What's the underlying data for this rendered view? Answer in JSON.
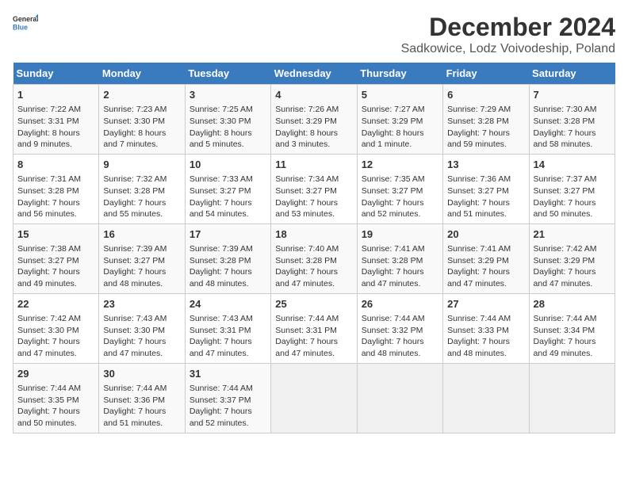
{
  "header": {
    "logo_line1": "General",
    "logo_line2": "Blue",
    "title": "December 2024",
    "subtitle": "Sadkowice, Lodz Voivodeship, Poland"
  },
  "calendar": {
    "days_of_week": [
      "Sunday",
      "Monday",
      "Tuesday",
      "Wednesday",
      "Thursday",
      "Friday",
      "Saturday"
    ],
    "weeks": [
      [
        {
          "day": "1",
          "info": "Sunrise: 7:22 AM\nSunset: 3:31 PM\nDaylight: 8 hours\nand 9 minutes."
        },
        {
          "day": "2",
          "info": "Sunrise: 7:23 AM\nSunset: 3:30 PM\nDaylight: 8 hours\nand 7 minutes."
        },
        {
          "day": "3",
          "info": "Sunrise: 7:25 AM\nSunset: 3:30 PM\nDaylight: 8 hours\nand 5 minutes."
        },
        {
          "day": "4",
          "info": "Sunrise: 7:26 AM\nSunset: 3:29 PM\nDaylight: 8 hours\nand 3 minutes."
        },
        {
          "day": "5",
          "info": "Sunrise: 7:27 AM\nSunset: 3:29 PM\nDaylight: 8 hours\nand 1 minute."
        },
        {
          "day": "6",
          "info": "Sunrise: 7:29 AM\nSunset: 3:28 PM\nDaylight: 7 hours\nand 59 minutes."
        },
        {
          "day": "7",
          "info": "Sunrise: 7:30 AM\nSunset: 3:28 PM\nDaylight: 7 hours\nand 58 minutes."
        }
      ],
      [
        {
          "day": "8",
          "info": "Sunrise: 7:31 AM\nSunset: 3:28 PM\nDaylight: 7 hours\nand 56 minutes."
        },
        {
          "day": "9",
          "info": "Sunrise: 7:32 AM\nSunset: 3:28 PM\nDaylight: 7 hours\nand 55 minutes."
        },
        {
          "day": "10",
          "info": "Sunrise: 7:33 AM\nSunset: 3:27 PM\nDaylight: 7 hours\nand 54 minutes."
        },
        {
          "day": "11",
          "info": "Sunrise: 7:34 AM\nSunset: 3:27 PM\nDaylight: 7 hours\nand 53 minutes."
        },
        {
          "day": "12",
          "info": "Sunrise: 7:35 AM\nSunset: 3:27 PM\nDaylight: 7 hours\nand 52 minutes."
        },
        {
          "day": "13",
          "info": "Sunrise: 7:36 AM\nSunset: 3:27 PM\nDaylight: 7 hours\nand 51 minutes."
        },
        {
          "day": "14",
          "info": "Sunrise: 7:37 AM\nSunset: 3:27 PM\nDaylight: 7 hours\nand 50 minutes."
        }
      ],
      [
        {
          "day": "15",
          "info": "Sunrise: 7:38 AM\nSunset: 3:27 PM\nDaylight: 7 hours\nand 49 minutes."
        },
        {
          "day": "16",
          "info": "Sunrise: 7:39 AM\nSunset: 3:27 PM\nDaylight: 7 hours\nand 48 minutes."
        },
        {
          "day": "17",
          "info": "Sunrise: 7:39 AM\nSunset: 3:28 PM\nDaylight: 7 hours\nand 48 minutes."
        },
        {
          "day": "18",
          "info": "Sunrise: 7:40 AM\nSunset: 3:28 PM\nDaylight: 7 hours\nand 47 minutes."
        },
        {
          "day": "19",
          "info": "Sunrise: 7:41 AM\nSunset: 3:28 PM\nDaylight: 7 hours\nand 47 minutes."
        },
        {
          "day": "20",
          "info": "Sunrise: 7:41 AM\nSunset: 3:29 PM\nDaylight: 7 hours\nand 47 minutes."
        },
        {
          "day": "21",
          "info": "Sunrise: 7:42 AM\nSunset: 3:29 PM\nDaylight: 7 hours\nand 47 minutes."
        }
      ],
      [
        {
          "day": "22",
          "info": "Sunrise: 7:42 AM\nSunset: 3:30 PM\nDaylight: 7 hours\nand 47 minutes."
        },
        {
          "day": "23",
          "info": "Sunrise: 7:43 AM\nSunset: 3:30 PM\nDaylight: 7 hours\nand 47 minutes."
        },
        {
          "day": "24",
          "info": "Sunrise: 7:43 AM\nSunset: 3:31 PM\nDaylight: 7 hours\nand 47 minutes."
        },
        {
          "day": "25",
          "info": "Sunrise: 7:44 AM\nSunset: 3:31 PM\nDaylight: 7 hours\nand 47 minutes."
        },
        {
          "day": "26",
          "info": "Sunrise: 7:44 AM\nSunset: 3:32 PM\nDaylight: 7 hours\nand 48 minutes."
        },
        {
          "day": "27",
          "info": "Sunrise: 7:44 AM\nSunset: 3:33 PM\nDaylight: 7 hours\nand 48 minutes."
        },
        {
          "day": "28",
          "info": "Sunrise: 7:44 AM\nSunset: 3:34 PM\nDaylight: 7 hours\nand 49 minutes."
        }
      ],
      [
        {
          "day": "29",
          "info": "Sunrise: 7:44 AM\nSunset: 3:35 PM\nDaylight: 7 hours\nand 50 minutes."
        },
        {
          "day": "30",
          "info": "Sunrise: 7:44 AM\nSunset: 3:36 PM\nDaylight: 7 hours\nand 51 minutes."
        },
        {
          "day": "31",
          "info": "Sunrise: 7:44 AM\nSunset: 3:37 PM\nDaylight: 7 hours\nand 52 minutes."
        },
        {
          "day": "",
          "info": ""
        },
        {
          "day": "",
          "info": ""
        },
        {
          "day": "",
          "info": ""
        },
        {
          "day": "",
          "info": ""
        }
      ]
    ]
  }
}
